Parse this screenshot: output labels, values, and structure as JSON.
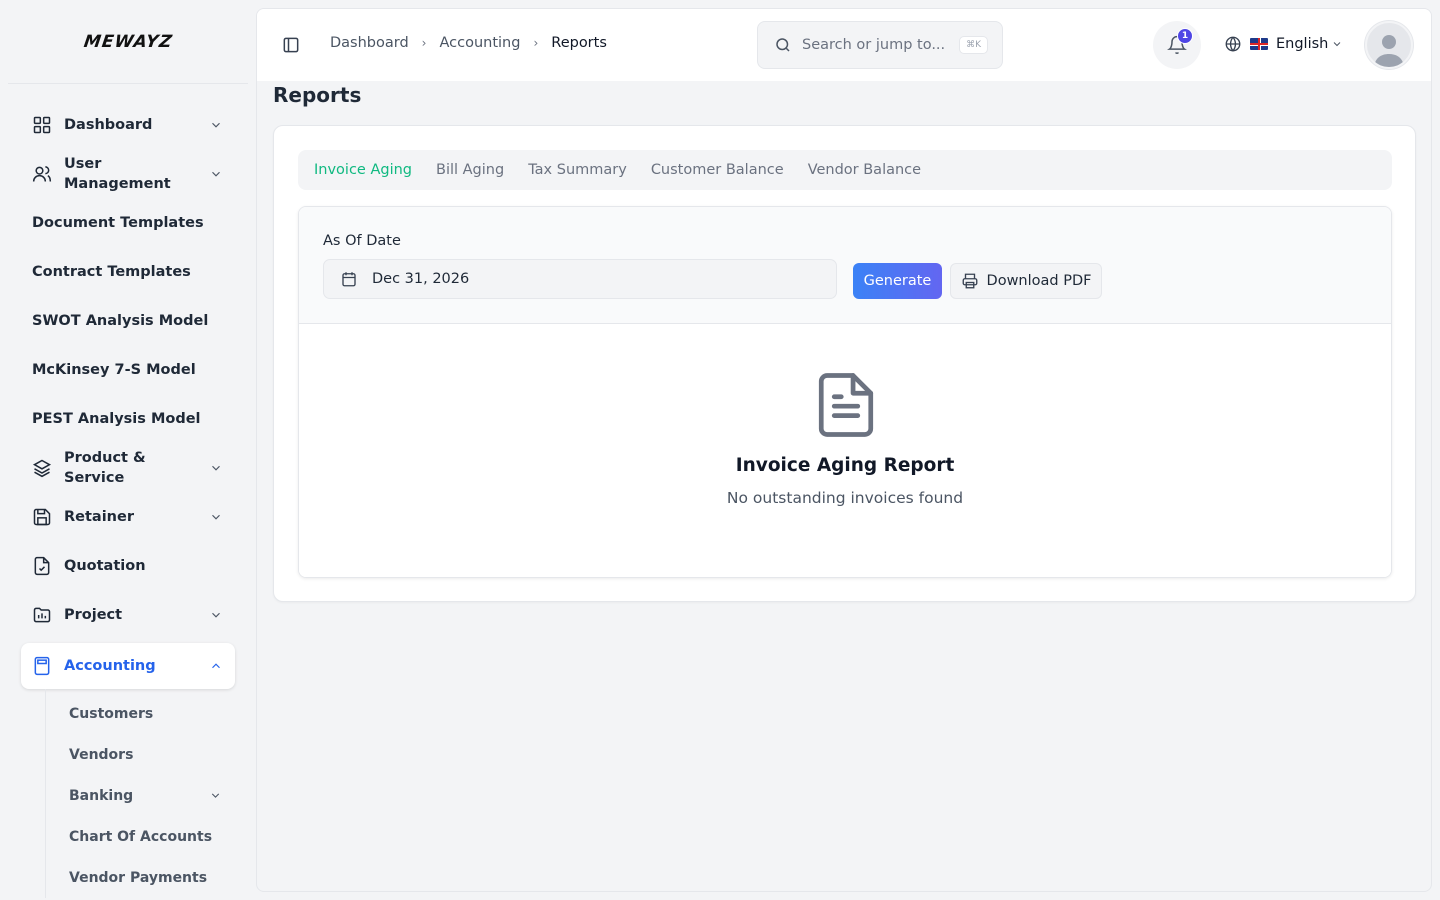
{
  "brand": {
    "logo_text": "MEWAYZ"
  },
  "sidebar": {
    "items": [
      {
        "label": "Dashboard",
        "icon": "grid-icon",
        "has_chevron": true
      },
      {
        "label": "User Management",
        "icon": "users-icon",
        "has_chevron": true
      },
      {
        "label": "Document Templates"
      },
      {
        "label": "Contract Templates"
      },
      {
        "label": "SWOT Analysis Model"
      },
      {
        "label": "McKinsey 7-S Model"
      },
      {
        "label": "PEST Analysis Model"
      },
      {
        "label": "Product & Service",
        "icon": "layers-icon",
        "has_chevron": true
      },
      {
        "label": "Retainer",
        "icon": "save-icon",
        "has_chevron": true
      },
      {
        "label": "Quotation",
        "icon": "file-check-icon"
      },
      {
        "label": "Project",
        "icon": "folder-chart-icon",
        "has_chevron": true
      },
      {
        "label": "Accounting",
        "icon": "calculator-icon",
        "has_chevron": true,
        "active": true
      }
    ],
    "accounting_sub": [
      {
        "label": "Customers"
      },
      {
        "label": "Vendors"
      },
      {
        "label": "Banking",
        "has_chevron": true
      },
      {
        "label": "Chart Of Accounts"
      },
      {
        "label": "Vendor Payments"
      }
    ]
  },
  "header": {
    "breadcrumb": [
      "Dashboard",
      "Accounting",
      "Reports"
    ],
    "search_placeholder": "Search or jump to...",
    "search_shortcut": "⌘K",
    "notification_count": "1",
    "language": "English"
  },
  "page": {
    "title": "Reports",
    "tabs": [
      "Invoice Aging",
      "Bill Aging",
      "Tax Summary",
      "Customer Balance",
      "Vendor Balance"
    ],
    "active_tab": "Invoice Aging",
    "date_label": "As Of Date",
    "date_value": "Dec 31, 2026",
    "generate_label": "Generate",
    "download_label": "Download PDF",
    "empty_title": "Invoice Aging Report",
    "empty_subtitle": "No outstanding invoices found"
  },
  "colors": {
    "accent": "#2563eb",
    "active_tab": "#10b981",
    "generate_start": "#3b82f6",
    "generate_end": "#6366f1",
    "badge": "#4f46e5"
  }
}
